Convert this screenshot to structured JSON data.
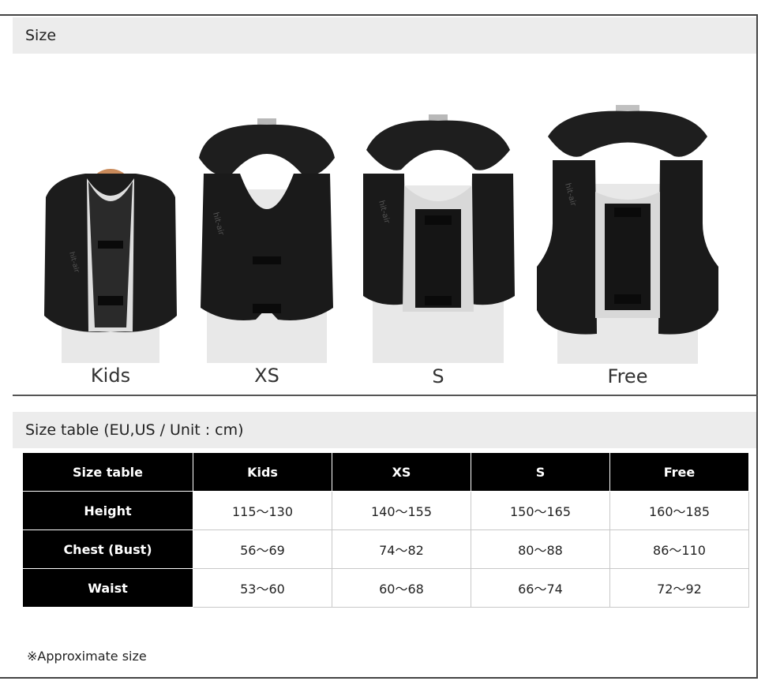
{
  "sections": {
    "size_title": "Size",
    "table_title": "Size table (EU,US / Unit : cm)"
  },
  "vests": [
    {
      "label": "Kids"
    },
    {
      "label": "XS"
    },
    {
      "label": "S"
    },
    {
      "label": "Free"
    }
  ],
  "table": {
    "corner": "Size table",
    "columns": [
      "Kids",
      "XS",
      "S",
      "Free"
    ],
    "rows": [
      {
        "label": "Height",
        "values": [
          "115〜130",
          "140〜155",
          "150〜165",
          "160〜185"
        ]
      },
      {
        "label": "Chest (Bust)",
        "values": [
          "56〜69",
          "74〜82",
          "80〜88",
          "86〜110"
        ]
      },
      {
        "label": "Waist",
        "values": [
          "53〜60",
          "60〜68",
          "66〜74",
          "72〜92"
        ]
      }
    ]
  },
  "note": "※Approximate size"
}
